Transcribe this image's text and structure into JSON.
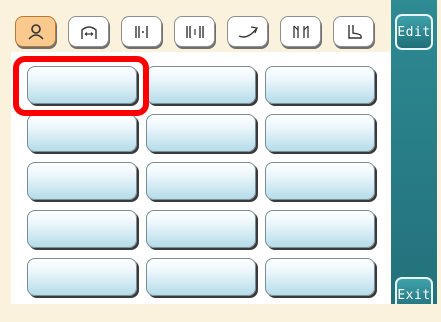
{
  "sidebar": {
    "edit_label": "Edit",
    "exit_label": "Exit",
    "color": "#2a7f89"
  },
  "tabs": [
    {
      "icon": "user-icon",
      "active": true
    },
    {
      "icon": "arch-icon",
      "active": false
    },
    {
      "icon": "divider-icon",
      "active": false
    },
    {
      "icon": "columns-icon",
      "active": false
    },
    {
      "icon": "curve-icon",
      "active": false
    },
    {
      "icon": "split-icon",
      "active": false
    },
    {
      "icon": "foot-icon",
      "active": false
    }
  ],
  "grid": {
    "rows": 5,
    "cols": 3,
    "selected_index": 0,
    "highlight_color": "#ff0000"
  }
}
